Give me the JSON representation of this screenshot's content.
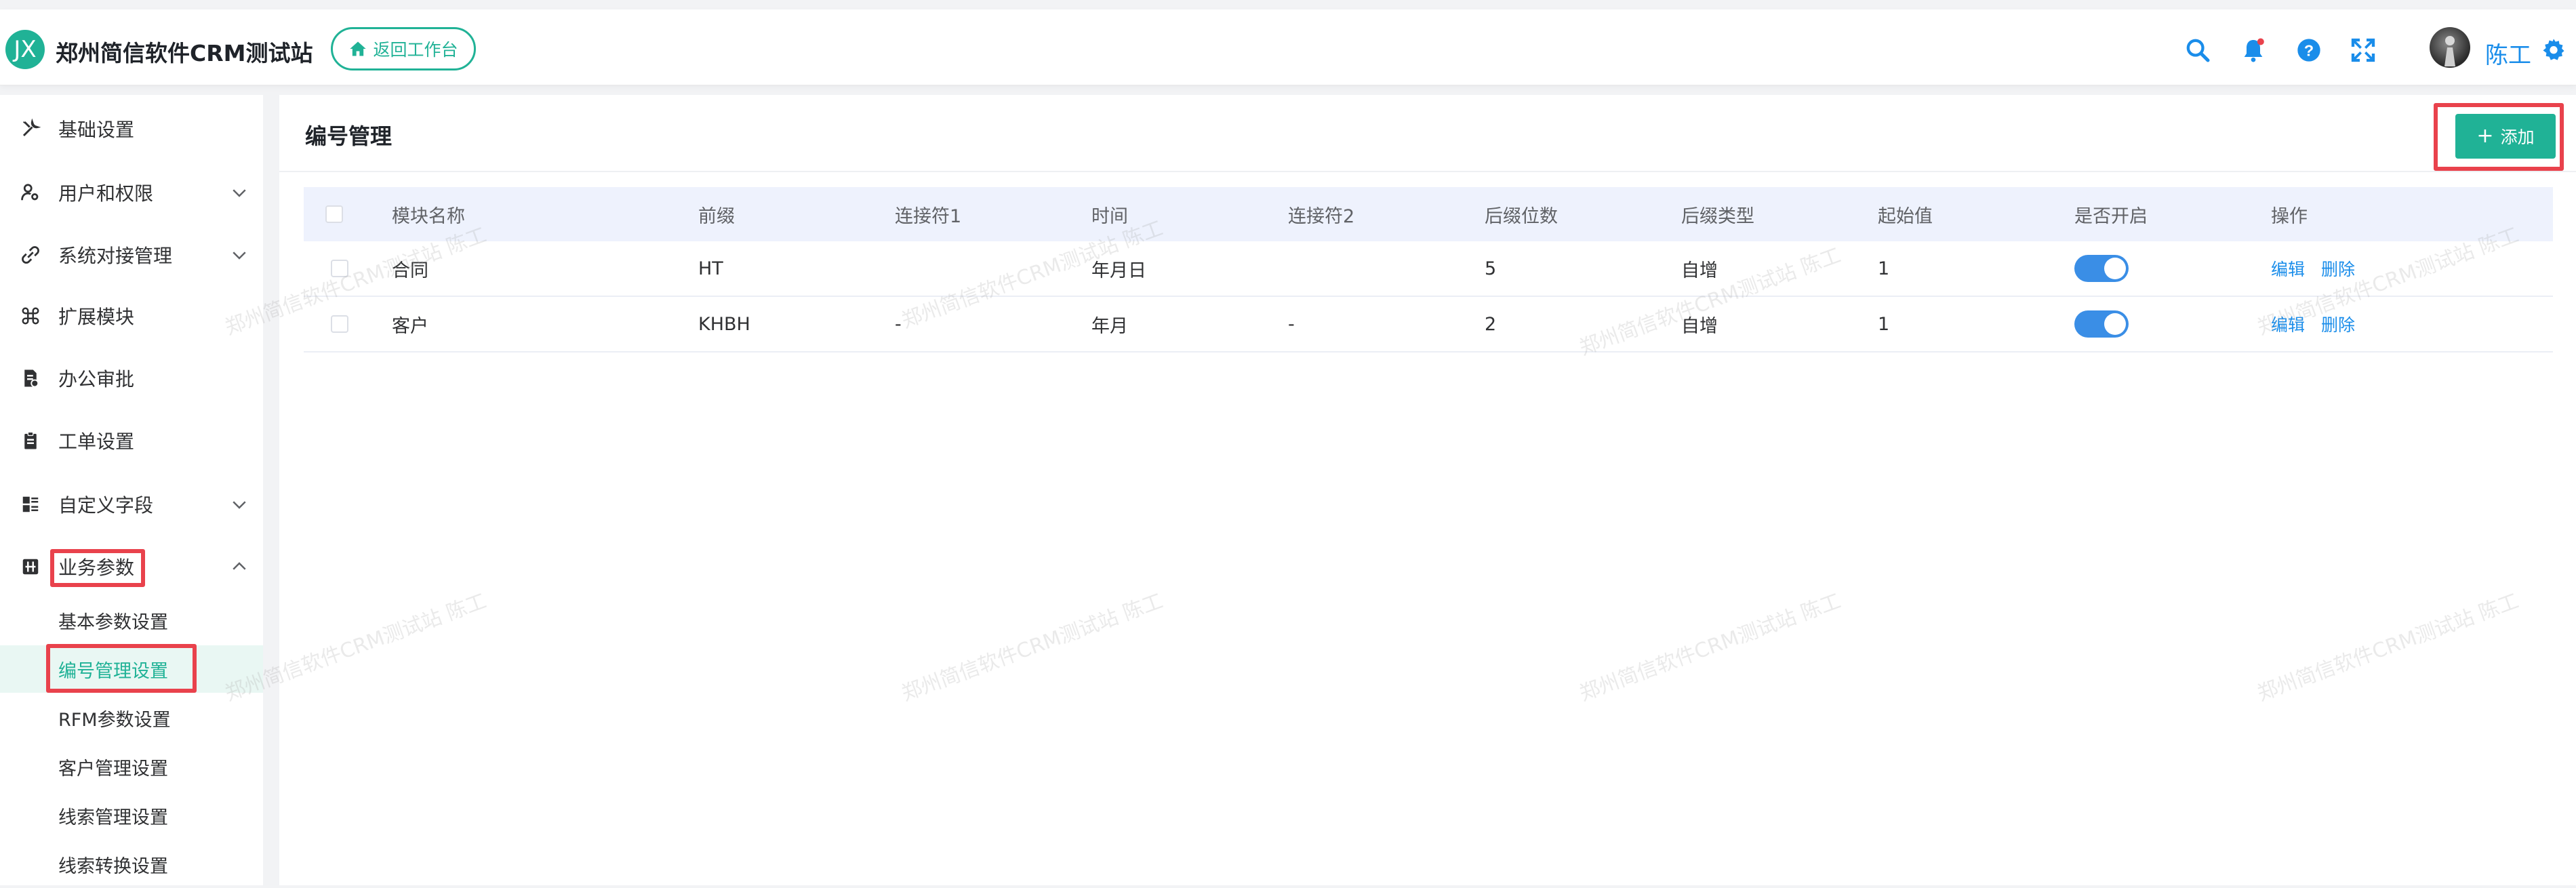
{
  "header": {
    "logo_text": "JX",
    "app_title": "郑州简信软件CRM测试站",
    "back_button": "返回工作台",
    "username": "陈工"
  },
  "colors": {
    "accent": "#20b296",
    "link": "#1a8dea",
    "highlight": "#e9424c"
  },
  "sidebar": {
    "items": [
      {
        "label": "基础设置",
        "icon": "tools-icon"
      },
      {
        "label": "用户和权限",
        "icon": "user-key-icon",
        "expandable": true
      },
      {
        "label": "系统对接管理",
        "icon": "link-icon",
        "expandable": true
      },
      {
        "label": "扩展模块",
        "icon": "command-icon"
      },
      {
        "label": "办公审批",
        "icon": "doc-check-icon"
      },
      {
        "label": "工单设置",
        "icon": "clipboard-icon"
      },
      {
        "label": "自定义字段",
        "icon": "list-icon",
        "expandable": true
      },
      {
        "label": "业务参数",
        "icon": "grid-icon",
        "expandable": true,
        "expanded": true
      }
    ],
    "sub_items": [
      {
        "label": "基本参数设置"
      },
      {
        "label": "编号管理设置",
        "active": true
      },
      {
        "label": "RFM参数设置"
      },
      {
        "label": "客户管理设置"
      },
      {
        "label": "线索管理设置"
      },
      {
        "label": "线索转换设置"
      }
    ]
  },
  "main": {
    "title": "编号管理",
    "add_button": "添加",
    "columns": [
      "模块名称",
      "前缀",
      "连接符1",
      "时间",
      "连接符2",
      "后缀位数",
      "后缀类型",
      "起始值",
      "是否开启",
      "操作"
    ],
    "rows": [
      {
        "module": "合同",
        "prefix": "HT",
        "sep1": "",
        "time": "年月日",
        "sep2": "",
        "digits": "5",
        "type": "自增",
        "start": "1",
        "enabled": true
      },
      {
        "module": "客户",
        "prefix": "KHBH",
        "sep1": "-",
        "time": "年月",
        "sep2": "-",
        "digits": "2",
        "type": "自增",
        "start": "1",
        "enabled": true
      }
    ],
    "actions": {
      "edit": "编辑",
      "delete": "删除"
    }
  },
  "watermark": "郑州简信软件CRM测试站 陈工"
}
